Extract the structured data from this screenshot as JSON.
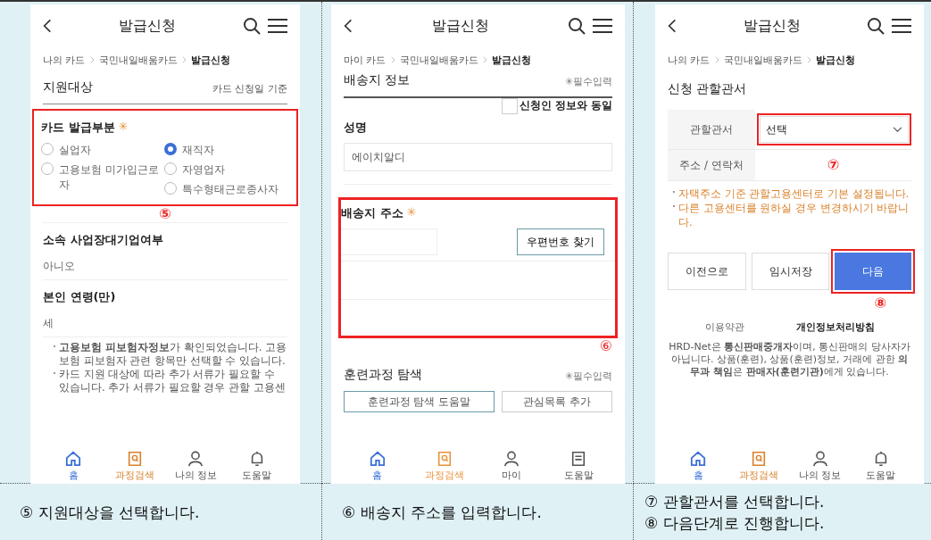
{
  "panels": [
    {
      "title": "발급신청",
      "breadcrumb": [
        "나의 카드",
        "국민내일배움카드",
        "발급신청"
      ],
      "section_title": "지원대상",
      "section_note": "카드 신청일 기준",
      "group": {
        "label": "카드 발급부분",
        "mark": "✳",
        "option_columns": [
          [
            {
              "label": "실업자",
              "selected": false
            },
            {
              "label": "고용보험 미가입근로자",
              "selected": false
            }
          ],
          [
            {
              "label": "재직자",
              "selected": true
            },
            {
              "label": "자영업자",
              "selected": false
            },
            {
              "label": "특수형태근로종사자",
              "selected": false
            }
          ]
        ]
      },
      "marker": "⑤",
      "fields": [
        {
          "label": "소속 사업장대기업여부",
          "value": "아니오"
        },
        {
          "label": "본인 연령(만)",
          "value": "세"
        }
      ],
      "notes": [
        "**고용보험 피보험자정보**가 확인되었습니다. 고용보험 피보험자 관련 항목만 선택할 수 있습니다.",
        "카드 지원 대상에 따라 추가 서류가 필요할 수 있습니다. 추가 서류가 필요할 경우 관할 고용센"
      ],
      "nav": [
        {
          "label": "홈",
          "color": "#3b6fd6"
        },
        {
          "label": "과정검색",
          "color": "#d9822b"
        },
        {
          "label": "나의 정보",
          "color": "#555555"
        },
        {
          "label": "도움말",
          "color": "#555555"
        }
      ],
      "captions": [
        "⑤ 지원대상을 선택합니다."
      ]
    },
    {
      "title": "발급신청",
      "breadcrumb": [
        "마이 카드",
        "국민내일배움카드",
        "발급신청"
      ],
      "section_title": "배송지 정보",
      "section_note": "✳필수입력",
      "same_as_applicant": {
        "label": "신청인 정보와 동일",
        "checked": false
      },
      "name_field": {
        "label": "성명",
        "value": "에이치알디"
      },
      "address": {
        "label": "배송지 주소",
        "mark": "✳",
        "button": "우편번호 찾기"
      },
      "marker": "⑥",
      "search_section": {
        "title": "훈련과정 탐색",
        "note": "✳필수입력",
        "buttons": [
          "훈련과정 탐색 도움말",
          "관심목록 추가"
        ]
      },
      "nav": [
        {
          "label": "홈",
          "color": "#3b6fd6"
        },
        {
          "label": "과정검색",
          "color": "#e8923a"
        },
        {
          "label": "마이",
          "color": "#555555"
        },
        {
          "label": "도움말",
          "color": "#555555"
        }
      ],
      "captions": [
        "⑥ 배송지 주소를 입력합니다."
      ]
    },
    {
      "title": "발급신청",
      "breadcrumb": [
        "나의 카드",
        "국민내일배움카드",
        "발급신청"
      ],
      "section_title": "신청 관할관서",
      "rows": [
        {
          "label": "관할관서",
          "kind": "select",
          "value": "선택"
        },
        {
          "label": "주소 / 연락처",
          "kind": "text"
        }
      ],
      "marker": "⑦",
      "notes": [
        "자택주소 기준 관할고용센터로 기본 설정됩니다.",
        "다른 고용센터를 원하실 경우 변경하시기 바랍니다."
      ],
      "buttons": [
        {
          "label": "이전으로",
          "kind": "secondary"
        },
        {
          "label": "임시저장",
          "kind": "secondary"
        },
        {
          "label": "다음",
          "kind": "primary"
        }
      ],
      "button_marker": "⑧",
      "footer_links": [
        {
          "label": "이용약관",
          "emphasized": false
        },
        {
          "label": "개인정보처리방침",
          "emphasized": true
        }
      ],
      "footer_text": "HRD-Net은 **통신판매중개자**이며, 통신판매의 당사자가 아닙니다. 상품(훈련), 상품(훈련)정보, 거래에 관한 **의무과 책임**은 **판매자(훈련기관)**에게 있습니다.",
      "nav": [
        {
          "label": "홈",
          "color": "#3b6fd6"
        },
        {
          "label": "과정검색",
          "color": "#d9822b"
        },
        {
          "label": "나의 정보",
          "color": "#555555"
        },
        {
          "label": "도움말",
          "color": "#555555"
        }
      ],
      "captions": [
        "⑦ 관할관서를 선택합니다.",
        "⑧ 다음단계로 진행합니다."
      ]
    }
  ]
}
